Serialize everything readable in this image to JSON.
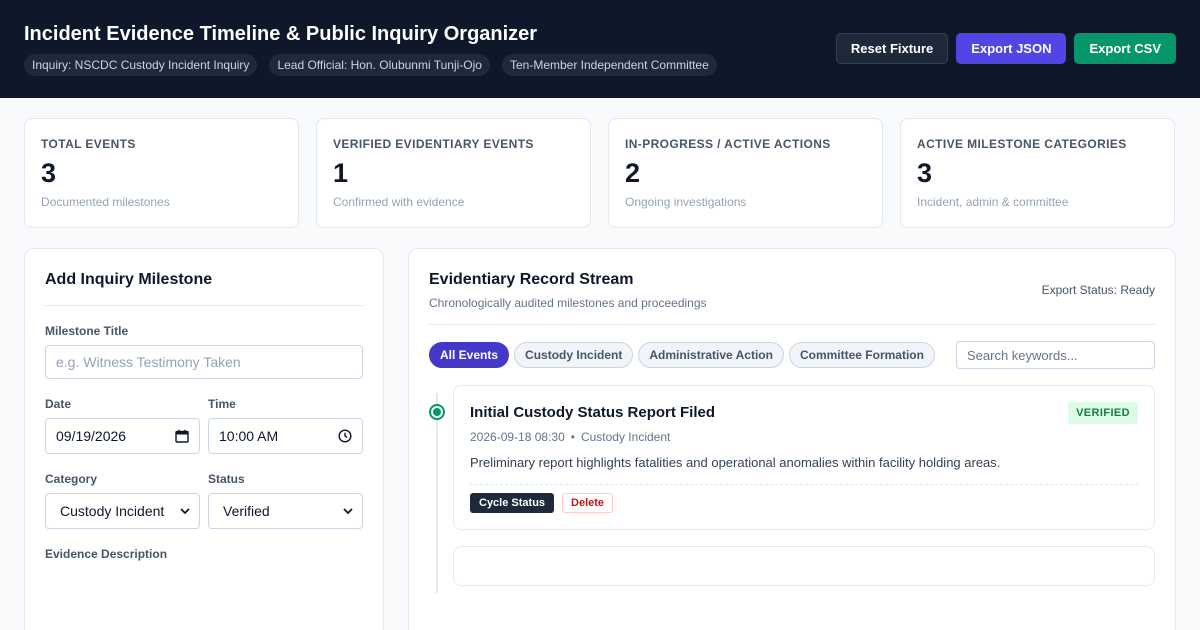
{
  "header": {
    "title": "Incident Evidence Timeline & Public Inquiry Organizer",
    "chips": [
      "Inquiry: NSCDC Custody Incident Inquiry",
      "Lead Official: Hon. Olubunmi Tunji-Ojo",
      "Ten-Member Independent Committee"
    ],
    "actions": {
      "reset": "Reset Fixture",
      "export_json": "Export JSON",
      "export_csv": "Export CSV"
    }
  },
  "stats": [
    {
      "label": "Total Events",
      "value": "3",
      "sub": "Documented milestones"
    },
    {
      "label": "Verified Evidentiary Events",
      "value": "1",
      "sub": "Confirmed with evidence"
    },
    {
      "label": "In-Progress / Active Actions",
      "value": "2",
      "sub": "Ongoing investigations"
    },
    {
      "label": "Active Milestone Categories",
      "value": "3",
      "sub": "Incident, admin & committee"
    }
  ],
  "form": {
    "title": "Add Inquiry Milestone",
    "milestone_title_label": "Milestone Title",
    "milestone_title_placeholder": "e.g. Witness Testimony Taken",
    "date_label": "Date",
    "date_value": "09/19/2026",
    "time_label": "Time",
    "time_value": "10:00 AM",
    "category_label": "Category",
    "category_value": "Custody Incident",
    "status_label": "Status",
    "status_value": "Verified",
    "evidence_label": "Evidence Description"
  },
  "stream": {
    "title": "Evidentiary Record Stream",
    "subtitle": "Chronologically audited milestones and proceedings",
    "export_status": "Export Status: Ready",
    "filters": [
      "All Events",
      "Custody Incident",
      "Administrative Action",
      "Committee Formation"
    ],
    "active_filter": "All Events",
    "search_placeholder": "Search keywords...",
    "events": [
      {
        "title": "Initial Custody Status Report Filed",
        "badge": "VERIFIED",
        "datetime": "2026-09-18 08:30",
        "category": "Custody Incident",
        "description": "Preliminary report highlights fatalities and operational anomalies within facility holding areas.",
        "cycle_label": "Cycle Status",
        "delete_label": "Delete"
      }
    ]
  },
  "colors": {
    "header_bg": "#0f172a",
    "accent_indigo": "#4f46e5",
    "accent_green": "#059669",
    "verified_badge_bg": "#dcfce7",
    "verified_badge_text": "#15803d"
  }
}
